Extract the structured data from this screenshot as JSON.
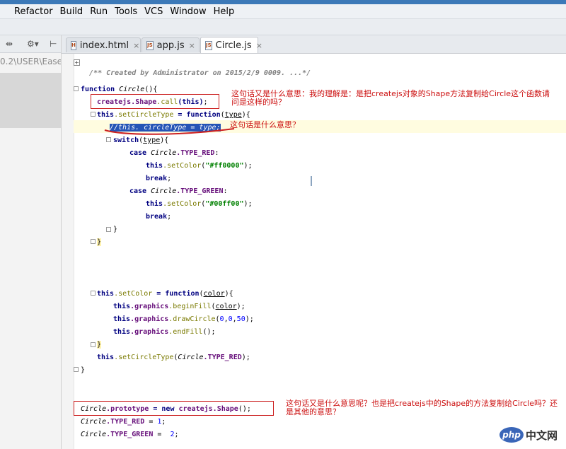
{
  "menu": [
    "Refactor",
    "Build",
    "Run",
    "Tools",
    "VCS",
    "Window",
    "Help"
  ],
  "left_panel": {
    "path": "0.2\\USER\\Ease",
    "icons": [
      "split-icon",
      "gear-icon",
      "collapse-icon"
    ]
  },
  "tabs": [
    {
      "label": "index.html",
      "icon": "html-file-icon",
      "active": false
    },
    {
      "label": "app.js",
      "icon": "js-file-icon",
      "active": false
    },
    {
      "label": "Circle.js",
      "icon": "js-file-icon",
      "active": true
    }
  ],
  "close_glyph": "×",
  "code": {
    "l1": "/** Created by Administrator on 2015/2/9 0009. ...*/",
    "function_kw": "function",
    "circle_fn": " Circle",
    "l3_rest": "(){",
    "createjs": "createjs",
    "shape_call_shape": ".Shape",
    "call": ".call",
    "this_arg": "(this)",
    "semicolon": ";",
    "this_kw": "this",
    "setCircleType": ".setCircleType",
    "eq_function": " = function",
    "type_param": "type",
    "l5_open": "){",
    "paren_open": "(",
    "comment_selected": "//this. circleType = type;",
    "switch_kw": "switch",
    "switch_rest": "){",
    "case_kw": "case",
    "circle_ref": " Circle",
    "type_red": ".TYPE_RED",
    "type_green": ".TYPE_GREEN",
    "colon": ":",
    "setColor": ".setColor",
    "red_str": "\"#ff0000\"",
    "green_str": "\"#00ff00\"",
    "close_paren_semicolon": ");",
    "break_kw": "break",
    "close_brace": "}",
    "setColor_assign": ".setColor",
    "color_param": "color",
    "graphics": ".graphics",
    "beginFill": ".beginFill",
    "drawCircle": ".drawCircle",
    "drawCircle_args_0": "0",
    "drawCircle_args_1": "0",
    "drawCircle_args_2": "50",
    "comma": ",",
    "endFill": ".endFill",
    "empty_call": "();",
    "circle_proto": "Circle",
    "prototype": ".prototype",
    "eq_new": " = new ",
    "shape_ctor": ".Shape",
    "ctor_end": "();",
    "type_red_assign": " = ",
    "one": "1",
    "type_green_assign": " =  ",
    "two": "2"
  },
  "annotations": {
    "a1": "这句话又是什么意思：我的理解是：是把createjs对象的Shape方法复制给Circle这个函数请\n问是这样的吗？",
    "a2": "这句话是什么意思？",
    "a3": "这句话又是什么意思呢？也是把createjs中的Shape的方法复制给Circle吗？还\n是其他的意思？"
  },
  "watermark": {
    "logo": "php",
    "text": "中文网"
  },
  "colors": {
    "annotation_red": "#cc2020",
    "selection_blue": "#2554b6",
    "keyword_navy": "#000080"
  }
}
